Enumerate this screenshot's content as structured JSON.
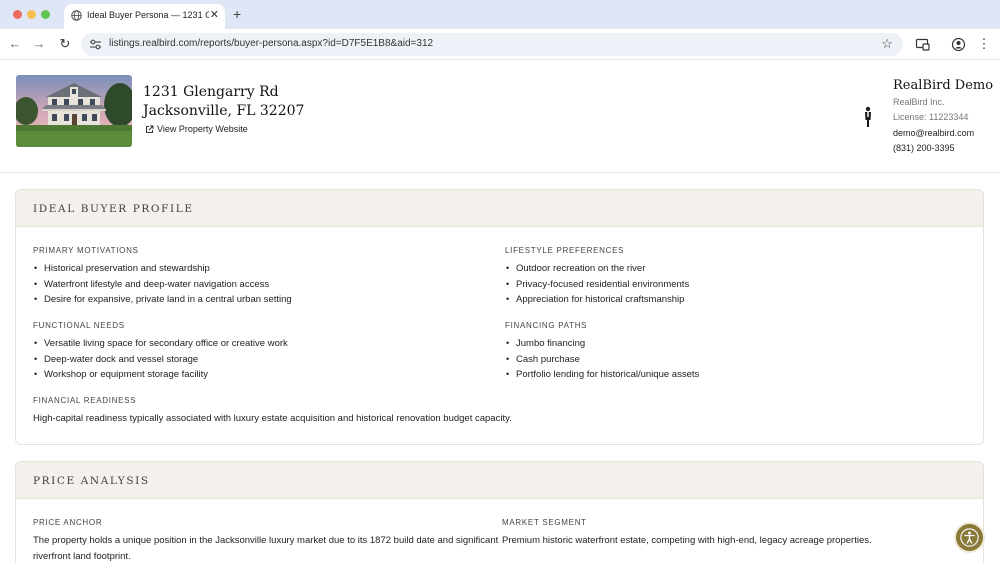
{
  "browser": {
    "tab_title": "Ideal Buyer Persona — 1231 G",
    "tab_close": "✕",
    "new_tab": "+",
    "url": "listings.realbird.com/reports/buyer-persona.aspx?id=D7F5E1B8&aid=312",
    "back": "←",
    "forward": "→",
    "reload": "↻",
    "bookmark": "☆",
    "menu": "⋮"
  },
  "property": {
    "address_line1": "1231 Glengarry Rd",
    "address_line2": "Jacksonville, FL 32207",
    "view_link": "View Property Website"
  },
  "agent": {
    "name": "RealBird Demo",
    "company": "RealBird Inc.",
    "license": "License: 11223344",
    "email": "demo@realbird.com",
    "phone": "(831) 200-3395"
  },
  "ideal_buyer": {
    "title": "IDEAL BUYER PROFILE",
    "primary_motivations": {
      "label": "PRIMARY MOTIVATIONS",
      "items": [
        "Historical preservation and stewardship",
        "Waterfront lifestyle and deep-water navigation access",
        "Desire for expansive, private land in a central urban setting"
      ]
    },
    "lifestyle_preferences": {
      "label": "LIFESTYLE PREFERENCES",
      "items": [
        "Outdoor recreation on the river",
        "Privacy-focused residential environments",
        "Appreciation for historical craftsmanship"
      ]
    },
    "functional_needs": {
      "label": "FUNCTIONAL NEEDS",
      "items": [
        "Versatile living space for secondary office or creative work",
        "Deep-water dock and vessel storage",
        "Workshop or equipment storage facility"
      ]
    },
    "financing_paths": {
      "label": "FINANCING PATHS",
      "items": [
        "Jumbo financing",
        "Cash purchase",
        "Portfolio lending for historical/unique assets"
      ]
    },
    "financial_readiness": {
      "label": "FINANCIAL READINESS",
      "text": "High-capital readiness typically associated with luxury estate acquisition and historical renovation budget capacity."
    }
  },
  "price_analysis": {
    "title": "PRICE ANALYSIS",
    "price_anchor": {
      "label": "PRICE ANCHOR",
      "text": "The property holds a unique position in the Jacksonville luxury market due to its 1872 build date and significant riverfront land footprint."
    },
    "market_segment": {
      "label": "MARKET SEGMENT",
      "text": "Premium historic waterfront estate, competing with high-end, legacy acreage properties."
    }
  },
  "colors": {
    "section_header_bg": "#f4f1ec",
    "accessibility_button": "#8a7a3a"
  }
}
